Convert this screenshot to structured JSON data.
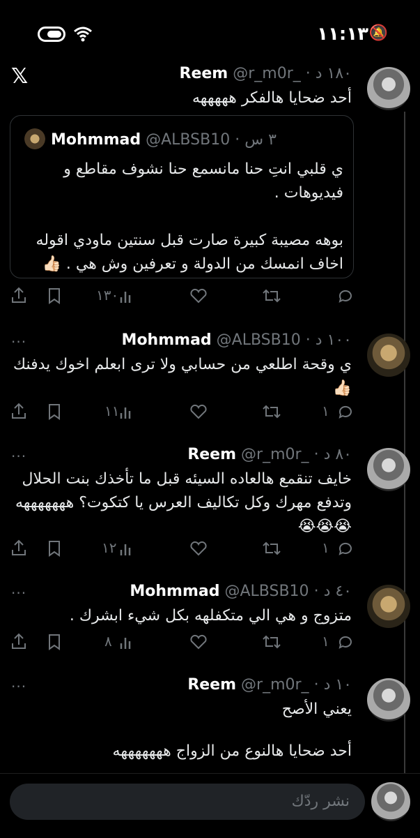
{
  "status_bar": {
    "time": "١١:١٣",
    "bell_icon": "bell-off-icon",
    "wifi_icon": "wifi-icon"
  },
  "header": {
    "logo": "𝕏"
  },
  "tweets": [
    {
      "name": "Reem",
      "handle": "@r_m0r_",
      "time": "١٨٠ د",
      "text": "أحد ضحايا هالفكر هههههه",
      "views": "١٣٠",
      "replies": ""
    },
    {
      "name": "Mohmmad",
      "handle": "@ALBSB10",
      "time": "١٠٠ د",
      "text": "ي وقحة اطلعي من حسابي ولا ترى ابعلم اخوك يدفنك 👍🏻",
      "views": "١١",
      "replies": "١"
    },
    {
      "name": "Reem",
      "handle": "@r_m0r_",
      "time": "٨٠ د",
      "text": "خايف تنقمع هالعاده السيئه قبل ما تأخذك بنت الحلال وتدفع مهرك وكل تكاليف العرس يا كتكوت؟ هههههههه 😭😭😭",
      "views": "١٢",
      "replies": "١"
    },
    {
      "name": "Mohmmad",
      "handle": "@ALBSB10",
      "time": "٤٠ د",
      "text": "متزوج و هي الي متكفلهه بكل شيء ابشرك .",
      "views": "٨",
      "replies": "١"
    },
    {
      "name": "Reem",
      "handle": "@r_m0r_",
      "time": "١٠ د",
      "text": "يعني الأصح",
      "text2": "أحد ضحايا هالنوع من الزواج هههههههه"
    }
  ],
  "quote": {
    "name": "Mohmmad",
    "handle": "@ALBSB10",
    "time": "٣ س",
    "text1": "ي قلبي انتِ حنا مانسمع حنا نشوف مقاطع و فيديوهات .",
    "text2": "بوهه مصيبة كبيرة صارت قبل سنتين ماودي اقوله اخاف انمسك من الدولة و تعرفين وش هي . 👍🏻"
  },
  "reply": {
    "placeholder": "نشر ردّك"
  },
  "more_label": "···",
  "dot": "·"
}
